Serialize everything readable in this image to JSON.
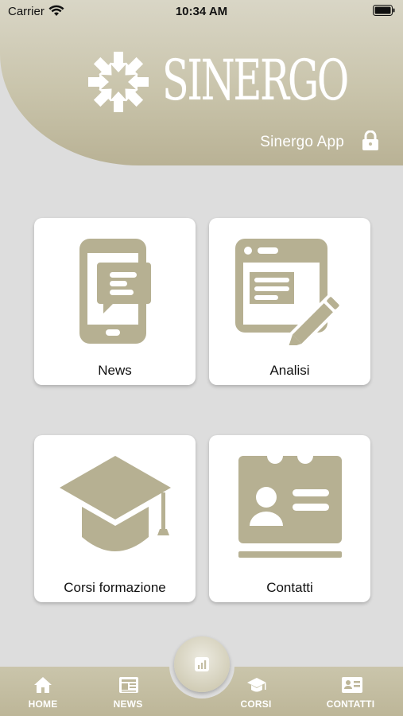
{
  "status_bar": {
    "carrier": "Carrier",
    "time": "10:34 AM"
  },
  "header": {
    "logo_text": "SINERGO",
    "app_name": "Sinergo App",
    "lock_icon": "lock-icon"
  },
  "tiles": [
    {
      "label": "News",
      "icon": "phone-chat-icon"
    },
    {
      "label": "Analisi",
      "icon": "browser-edit-icon"
    },
    {
      "label": "Corsi formazione",
      "icon": "graduation-cap-icon"
    },
    {
      "label": "Contatti",
      "icon": "contact-card-icon"
    }
  ],
  "bottom_nav": {
    "items": [
      {
        "label": "HOME",
        "icon": "home-icon"
      },
      {
        "label": "NEWS",
        "icon": "newspaper-icon"
      },
      {
        "label": "CORSI",
        "icon": "graduation-cap-icon"
      },
      {
        "label": "CONTATTI",
        "icon": "contact-card-icon"
      }
    ],
    "center_button_icon": "chart-icon"
  },
  "colors": {
    "accent": "#b7b196",
    "background": "#dddddd",
    "tile": "#ffffff",
    "icon": "#b6b092"
  }
}
